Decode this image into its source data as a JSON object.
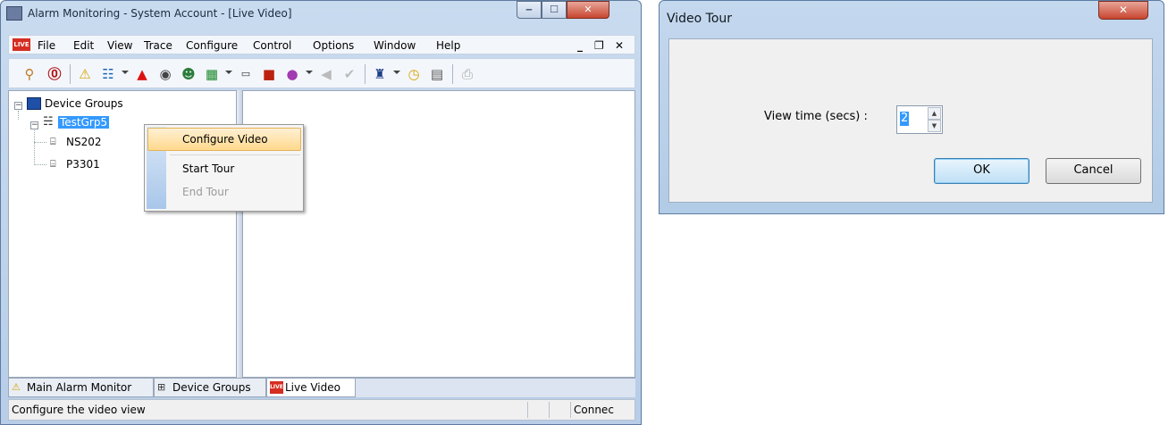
{
  "main_window": {
    "title": "Alarm Monitoring - System Account - [Live Video]",
    "caption_buttons": {
      "minimize": "‒",
      "maximize": "☐",
      "close": "✕"
    },
    "menu": {
      "app_icon_text": "LIVE",
      "items": [
        "File",
        "Edit",
        "View",
        "Trace",
        "Configure",
        "Control",
        "Options",
        "Window",
        "Help"
      ],
      "mdi_controls": {
        "minimize": "_",
        "restore": "❐",
        "close": "✕"
      }
    },
    "toolbar_icons": [
      "search-people-icon",
      "badge-icon",
      "alarm-icon",
      "tree-icon",
      "alarm-red-icon",
      "camera-disc-icon",
      "people-icon",
      "map-icon",
      "camera-icon",
      "video-icon",
      "color-icon",
      "arrow-icon",
      "check-icon",
      "guard-icon",
      "clock-icon",
      "report-icon",
      "print-icon"
    ],
    "tree": {
      "root": "Device Groups",
      "group": "TestGrp5",
      "devices": [
        "NS202",
        "P3301"
      ]
    },
    "context_menu": {
      "items": [
        {
          "label": "Configure Video",
          "state": "highlighted"
        },
        {
          "label": "Start Tour",
          "state": "enabled"
        },
        {
          "label": "End Tour",
          "state": "disabled"
        }
      ]
    },
    "tabs": [
      {
        "label": "Main Alarm Monitor",
        "icon": "alarm-bell-icon"
      },
      {
        "label": "Device Groups",
        "icon": "device-group-icon"
      },
      {
        "label": "Live Video",
        "icon": "live-icon",
        "active": true
      }
    ],
    "status_bar": {
      "message": "Configure the video view",
      "connection": "Connec"
    }
  },
  "dialog": {
    "title": "Video Tour",
    "close": "✕",
    "view_time_label": "View time (secs) :",
    "view_time_value": "2",
    "ok_label": "OK",
    "cancel_label": "Cancel"
  },
  "colors": {
    "title_gradient": "#c9dbef",
    "highlight": "#ffd98d",
    "selection": "#3399ff",
    "close_red": "#c8462f"
  }
}
